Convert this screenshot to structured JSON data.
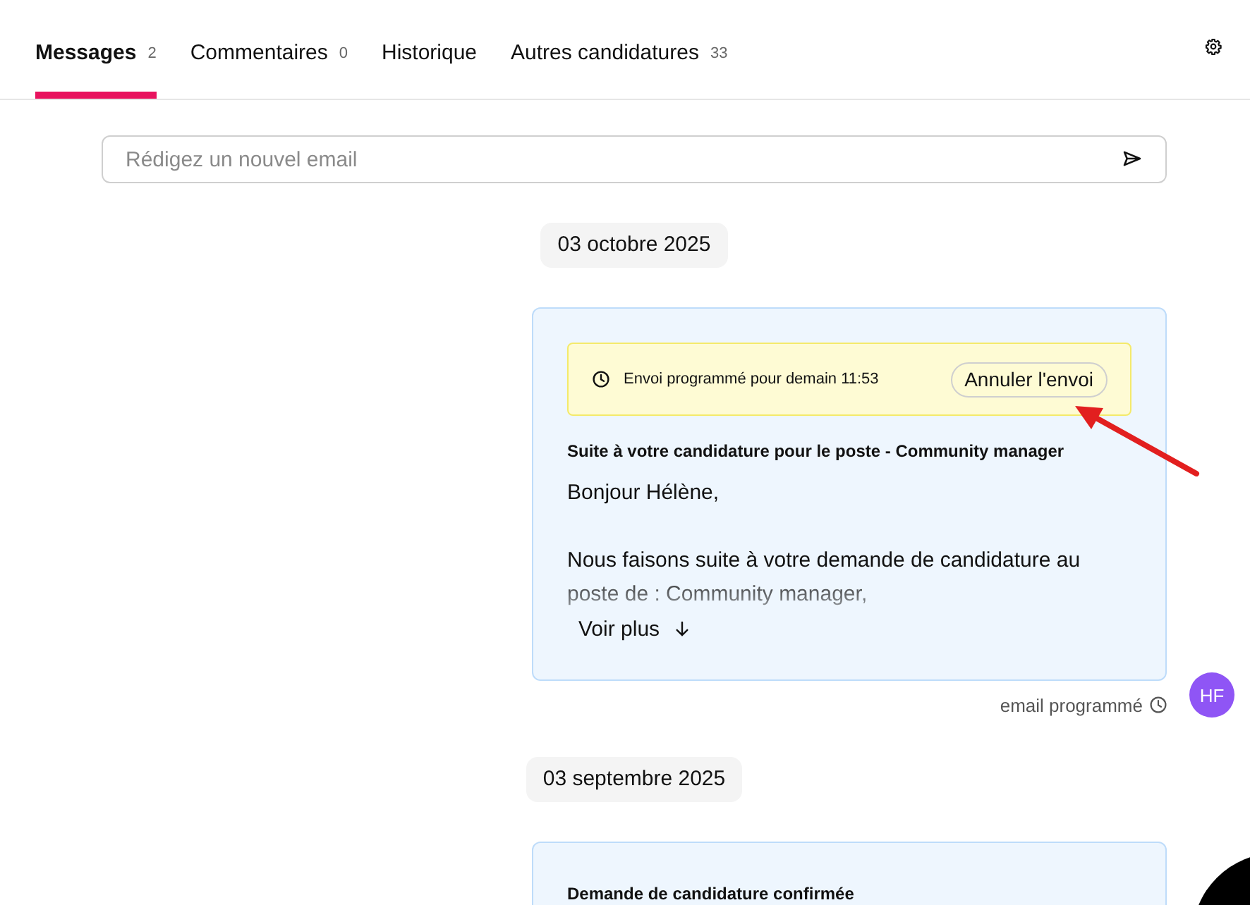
{
  "tabs": [
    {
      "label": "Messages",
      "count": "2",
      "selected": true
    },
    {
      "label": "Commentaires",
      "count": "0",
      "selected": false
    },
    {
      "label": "Historique",
      "selected": false
    },
    {
      "label": "Autres candidatures",
      "count": "33",
      "selected": false
    }
  ],
  "compose": {
    "placeholder": "Rédigez un nouvel email"
  },
  "thread": [
    {
      "date": "03 octobre 2025",
      "messages": [
        {
          "scheduled": {
            "text": "Envoi programmé pour demain 11:53",
            "cancel_button": "Annuler l'envoi"
          },
          "subject": "Suite à votre candidature pour le poste - Community manager",
          "body": [
            "Bonjour Hélène,",
            "Nous faisons suite à votre demande de candidature au poste de : Community manager,"
          ],
          "expanded": false,
          "more_button": "Voir plus",
          "status": "email programmé",
          "avatar": "HF"
        }
      ]
    },
    {
      "date": "03 septembre 2025",
      "messages": [
        {
          "subject": "Demande de candidature confirmée"
        }
      ]
    }
  ]
}
